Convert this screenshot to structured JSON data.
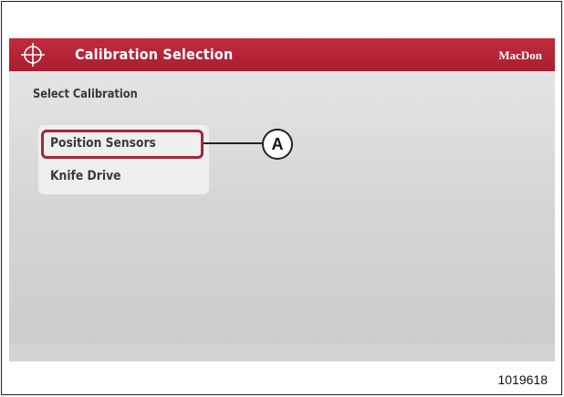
{
  "header": {
    "title": "Calibration Selection",
    "brand": "MacDon",
    "icon": "crosshair-icon",
    "color": "#b4243a"
  },
  "main": {
    "section_label": "Select Calibration",
    "menu_items": [
      {
        "label": "Position Sensors",
        "selected": true
      },
      {
        "label": "Knife Drive",
        "selected": false
      }
    ]
  },
  "callout": {
    "label": "A"
  },
  "figure_number": "1019618"
}
